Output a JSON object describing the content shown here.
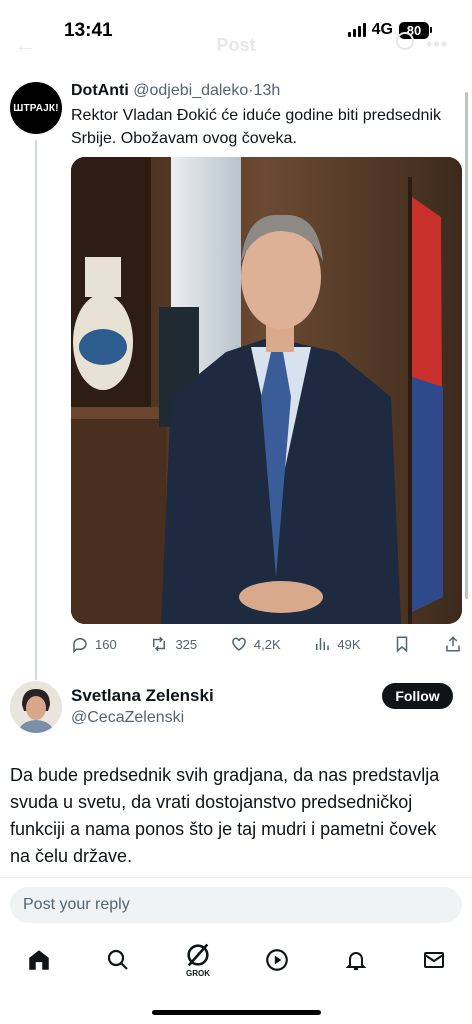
{
  "status_bar": {
    "time": "13:41",
    "network": "4G",
    "battery": "80"
  },
  "header": {
    "back": "←",
    "title": "Post",
    "more": "•••"
  },
  "post": {
    "avatar_text": "ШТРАЈК!",
    "author_name": "DotAnti",
    "handle": "@odjebi_daleko",
    "separator": "·",
    "time": "13h",
    "text": "Rektor Vladan Đokić će iduće godine biti predsednik Srbije. Obožavam ovog čoveka.",
    "stats": {
      "replies": "160",
      "reposts": "325",
      "likes": "4,2K",
      "views": "49K"
    }
  },
  "reply": {
    "name": "Svetlana Zelenski",
    "handle": "@CecaZelenski",
    "follow_label": "Follow",
    "text": "Da bude predsednik svih gradjana, da nas predstavlja svuda u svetu, da vrati dostojanstvo predsedničkoj funkciji a nama ponos što je taj mudri i pametni čovek na čelu države."
  },
  "reply_box": {
    "placeholder": "Post your reply"
  },
  "tab_bar": {
    "grok_label": "GROK"
  },
  "colors": {
    "text": "#0f1419",
    "secondary": "#536471",
    "divider": "#eff3f4",
    "follow_bg": "#0f1419"
  }
}
